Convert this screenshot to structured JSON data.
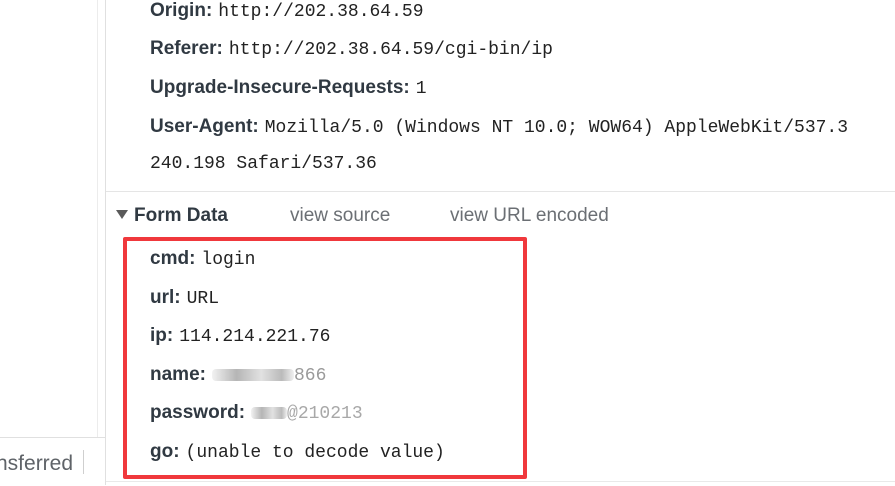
{
  "request_headers": {
    "origin": {
      "key": "Origin:",
      "value": "http://202.38.64.59"
    },
    "referer": {
      "key": "Referer:",
      "value": "http://202.38.64.59/cgi-bin/ip"
    },
    "upgrade": {
      "key": "Upgrade-Insecure-Requests:",
      "value": "1"
    },
    "user_agent": {
      "key": "User-Agent:",
      "value": "Mozilla/5.0 (Windows NT 10.0; WOW64) AppleWebKit/537.3",
      "continuation": "240.198 Safari/537.36"
    }
  },
  "form_data": {
    "title": "Form Data",
    "view_source": "view source",
    "view_url_encoded": "view URL encoded",
    "fields": {
      "cmd": {
        "key": "cmd:",
        "value": "login"
      },
      "url": {
        "key": "url:",
        "value": "URL"
      },
      "ip": {
        "key": "ip:",
        "value": "114.214.221.76"
      },
      "name": {
        "key": "name:",
        "value_hint": "866"
      },
      "password": {
        "key": "password:",
        "value_hint": "@210213"
      },
      "go": {
        "key": "go:",
        "value": "(unable to decode value)"
      }
    }
  },
  "left_pane": {
    "status_text": "nsferred"
  },
  "colors": {
    "highlight_border": "#f0383c",
    "key_text": "#303942",
    "link_text": "#6b6f74"
  }
}
